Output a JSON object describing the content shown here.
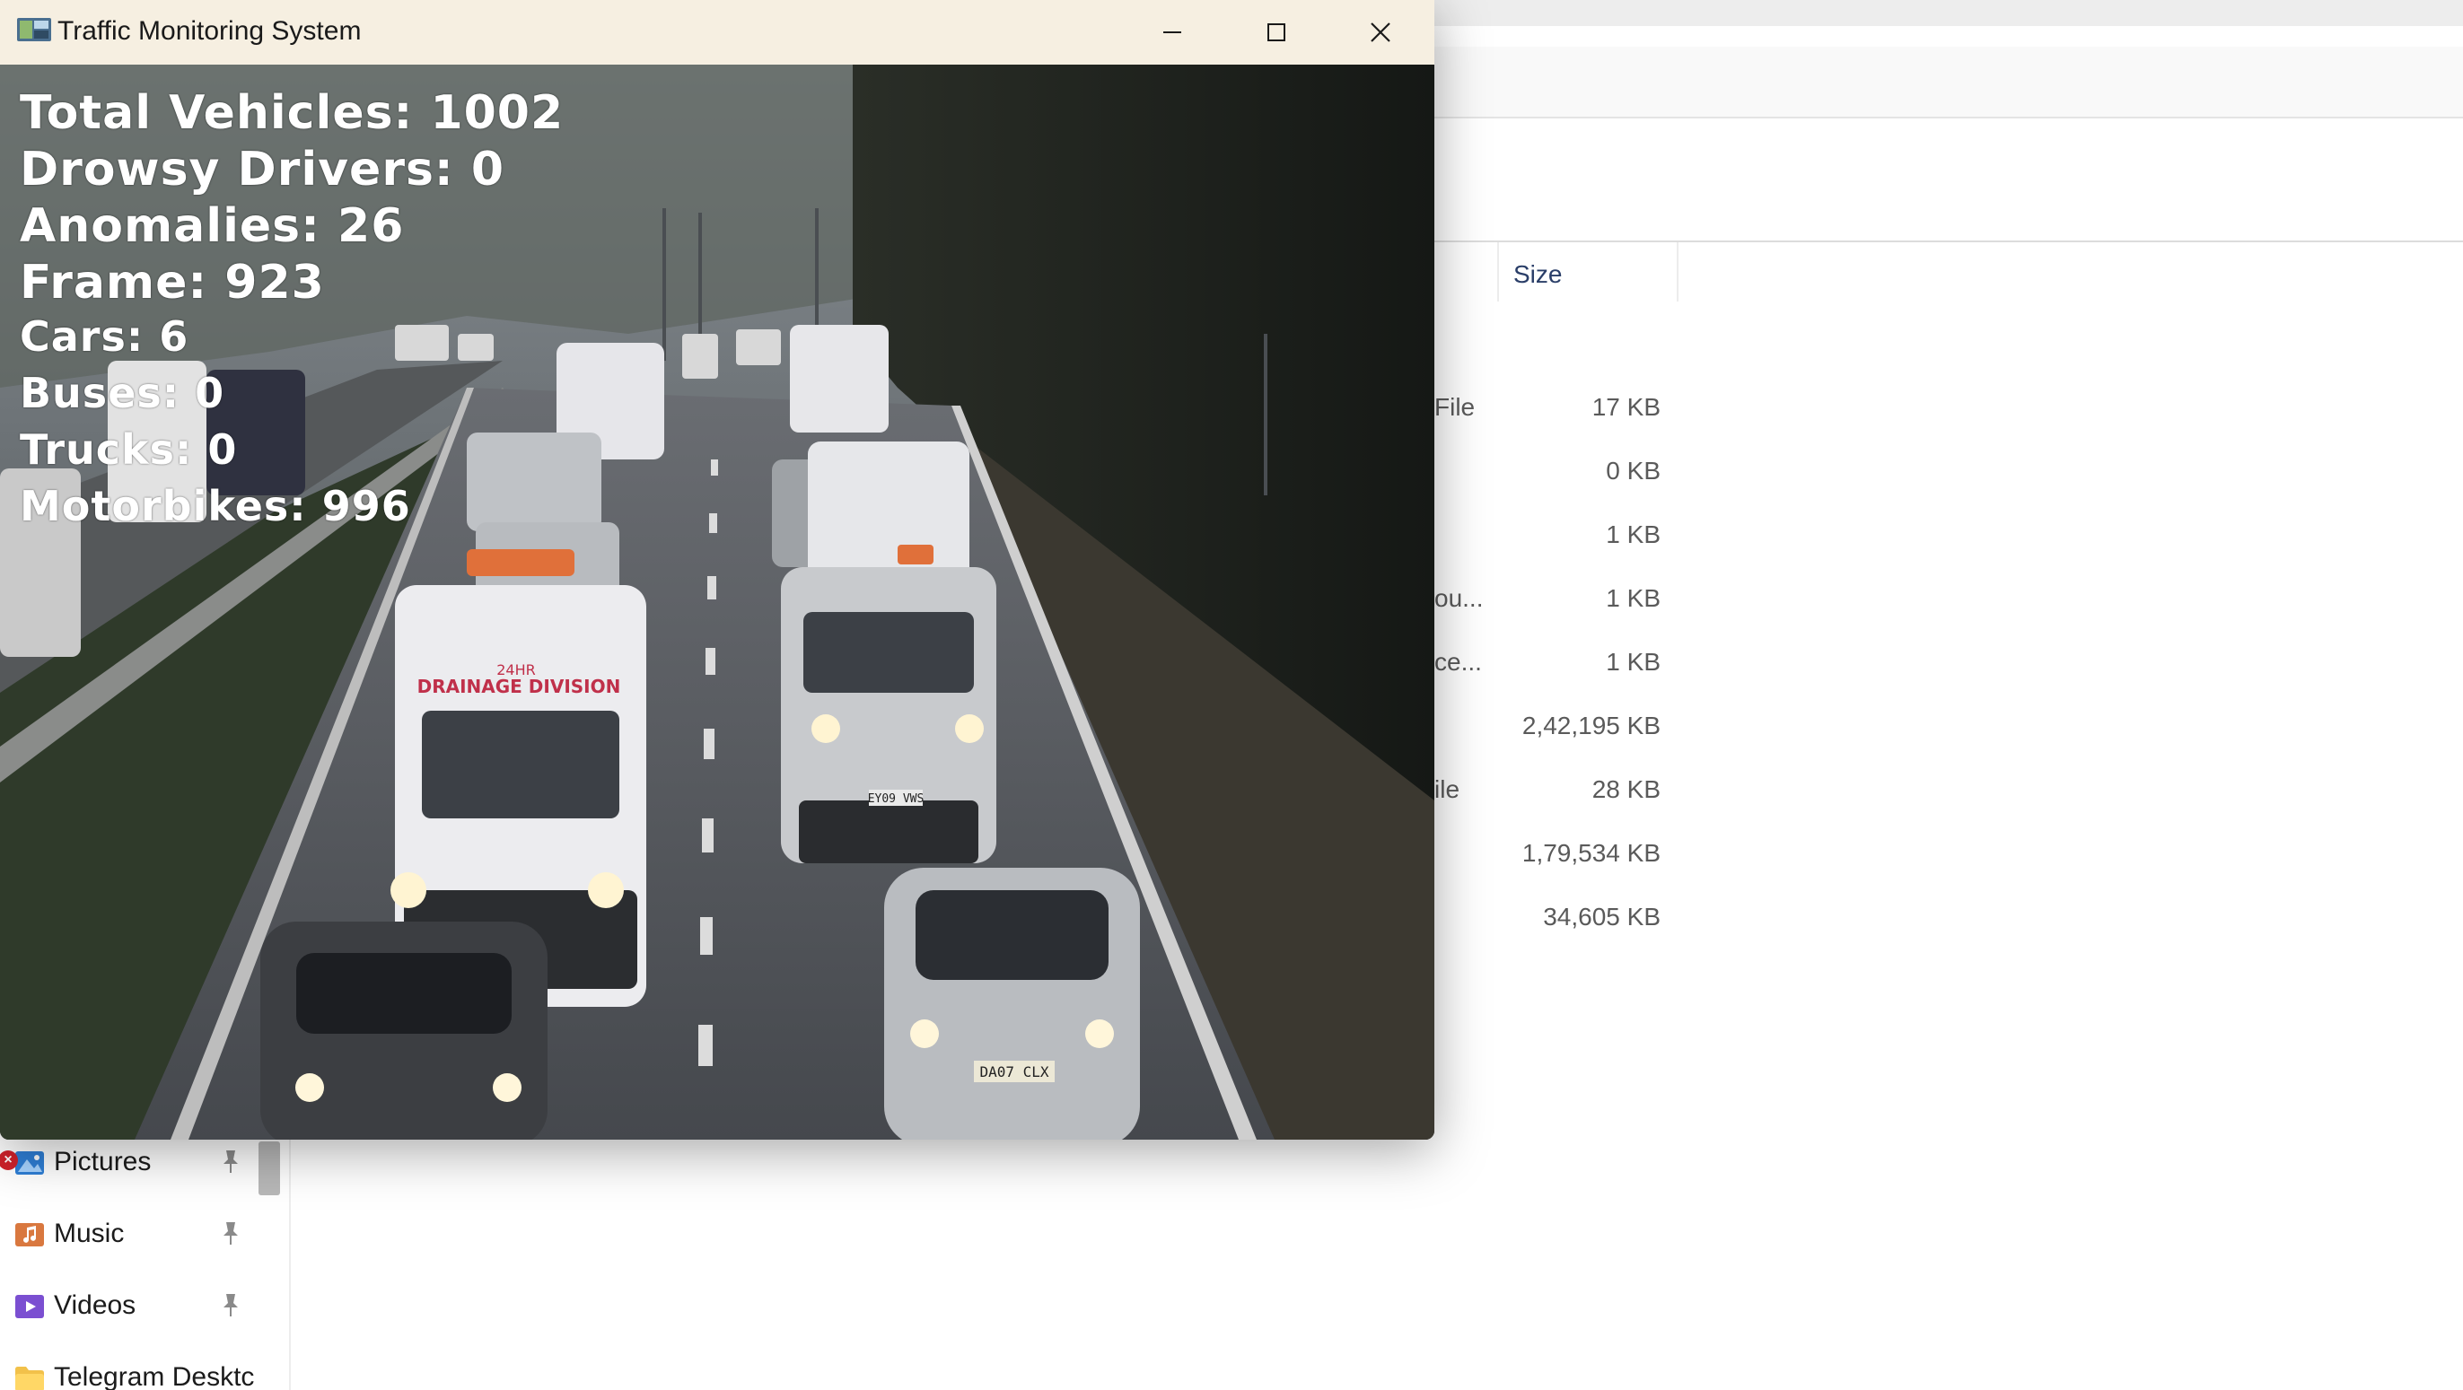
{
  "window": {
    "title": "Traffic Monitoring System",
    "buttons": {
      "minimize": "minimize-icon",
      "maximize": "maximize-icon",
      "close": "close-icon"
    }
  },
  "overlay": {
    "total_vehicles": "Total Vehicles: 1002",
    "drowsy_drivers": "Drowsy Drivers: 0",
    "anomalies": "Anomalies: 26",
    "frame": "Frame: 923",
    "cars": "Cars: 6",
    "buses": "Buses: 0",
    "trucks": "Trucks: 0",
    "motorbikes": "Motorbikes: 996"
  },
  "explorer": {
    "column_size": "Size",
    "files": [
      {
        "type": "File",
        "size": "17 KB"
      },
      {
        "type": "",
        "size": "0 KB"
      },
      {
        "type": "",
        "size": "1 KB"
      },
      {
        "type": "ou...",
        "size": "1 KB"
      },
      {
        "type": "ce...",
        "size": "1 KB"
      },
      {
        "type": "",
        "size": "2,42,195 KB"
      },
      {
        "type": "ile",
        "size": "28 KB"
      },
      {
        "type": "",
        "size": "1,79,534 KB"
      },
      {
        "type": "",
        "size": "34,605 KB"
      }
    ],
    "nav": [
      {
        "label": "Pictures",
        "icon": "pictures-icon",
        "pinned": true
      },
      {
        "label": "Music",
        "icon": "music-icon",
        "pinned": true
      },
      {
        "label": "Videos",
        "icon": "videos-icon",
        "pinned": true
      },
      {
        "label": "Telegram Desktc",
        "icon": "folder-icon",
        "pinned": false
      }
    ]
  },
  "colors": {
    "titlebar": "#f6efe1",
    "overlay_text": "#ffffff",
    "size_header": "#2a3e68",
    "error_badge": "#d0222b"
  }
}
